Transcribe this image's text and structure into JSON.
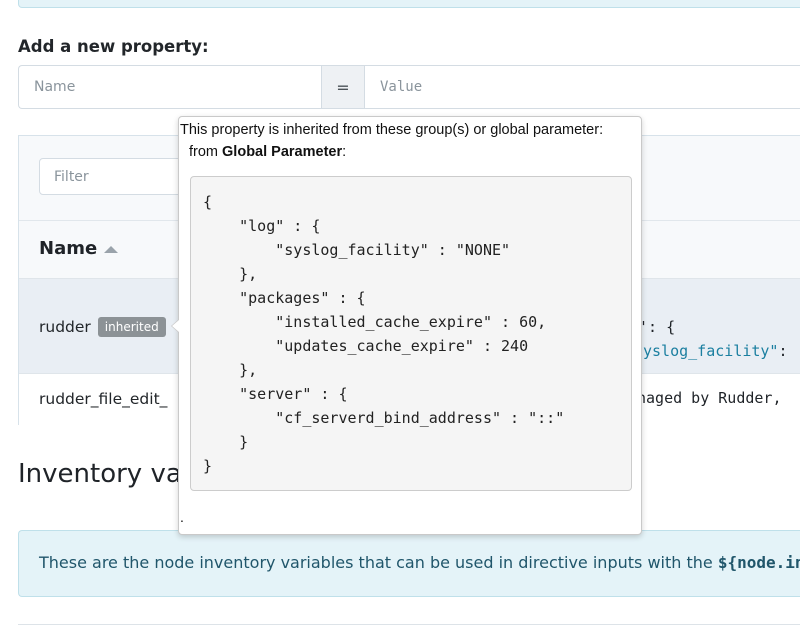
{
  "add_property": {
    "label": "Add a new property:",
    "name_placeholder": "Name",
    "equals": "=",
    "value_placeholder": "Value"
  },
  "table": {
    "filter_placeholder": "Filter",
    "name_header": "Name",
    "rows": [
      {
        "name": "rudder",
        "badge": "inherited",
        "value_line1": "': {",
        "value_line2_key": "yslog_facility\"",
        "value_line2_punct": ":"
      },
      {
        "name": "rudder_file_edit_",
        "value": "naged by Rudder,"
      }
    ]
  },
  "inventory": {
    "title": "Inventory var",
    "info_text": "These are the node inventory variables that can be used in directive inputs with the ",
    "info_code": "${node.in"
  },
  "popover": {
    "line1": "This property is inherited from these group(s) or global parameter:",
    "line2_prefix": "from ",
    "line2_bold": "Global Parameter",
    "line2_suffix": ":",
    "code": "{\n    \"log\" : {\n        \"syslog_facility\" : \"NONE\"\n    },\n    \"packages\" : {\n        \"installed_cache_expire\" : 60,\n        \"updates_cache_expire\" : 240\n    },\n    \"server\" : {\n        \"cf_serverd_bind_address\" : \"::\"\n    }\n}",
    "trailing": "."
  },
  "colors": {
    "info_background": "#e4f3f8",
    "info_text": "#20566b",
    "badge_background": "#8c9296",
    "selected_row": "#e9eef4",
    "json_key": "#1b7fa0"
  }
}
